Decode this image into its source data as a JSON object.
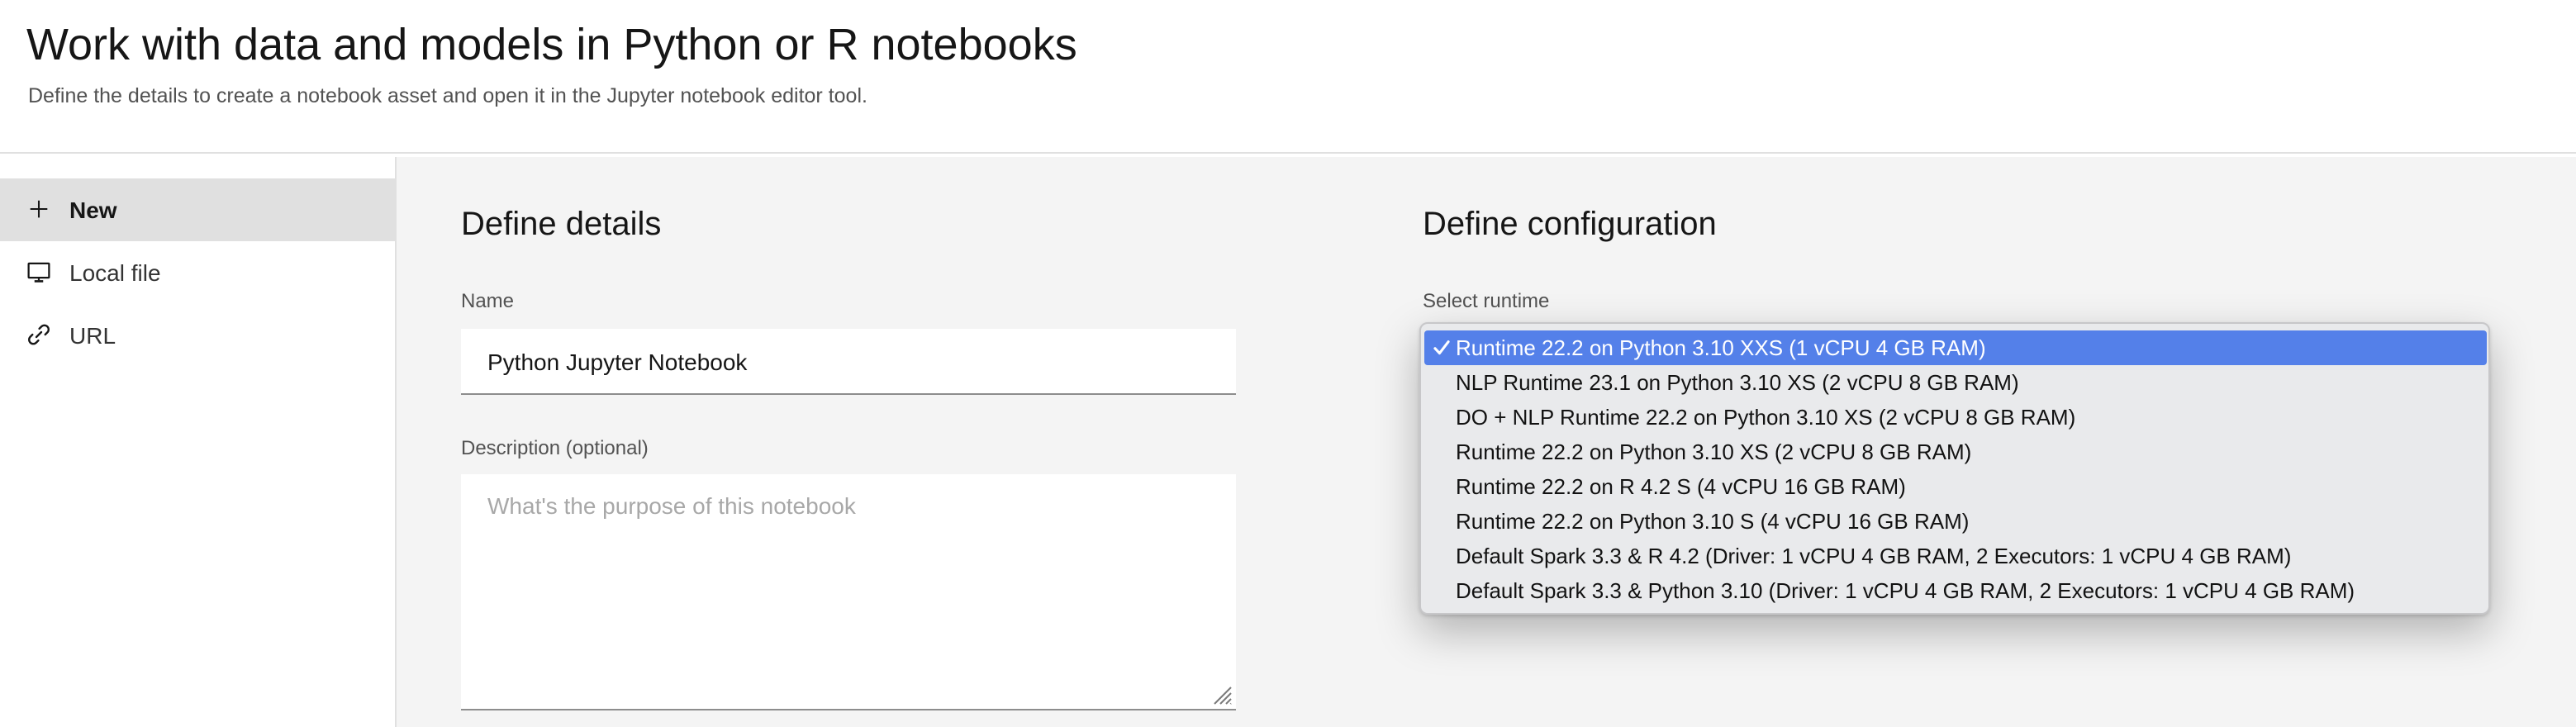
{
  "header": {
    "title": "Work with data and models in Python or R notebooks",
    "subtitle": "Define the details to create a notebook asset and open it in the Jupyter notebook editor tool."
  },
  "sidebar": {
    "items": [
      {
        "label": "New",
        "icon": "plus-icon",
        "selected": true
      },
      {
        "label": "Local file",
        "icon": "monitor-icon",
        "selected": false
      },
      {
        "label": "URL",
        "icon": "link-icon",
        "selected": false
      }
    ]
  },
  "details": {
    "heading": "Define details",
    "name_label": "Name",
    "name_value": "Python Jupyter Notebook",
    "description_label": "Description (optional)",
    "description_placeholder": "What's the purpose of this notebook"
  },
  "configuration": {
    "heading": "Define configuration",
    "runtime_label": "Select runtime",
    "selected_index": 0,
    "options": [
      "Runtime 22.2 on Python 3.10 XXS (1 vCPU 4 GB RAM)",
      "NLP Runtime 23.1 on Python 3.10 XS (2 vCPU 8 GB RAM)",
      "DO + NLP Runtime 22.2 on Python 3.10 XS (2 vCPU 8 GB RAM)",
      "Runtime 22.2 on Python 3.10 XS (2 vCPU 8 GB RAM)",
      "Runtime 22.2 on R 4.2 S (4 vCPU 16 GB RAM)",
      "Runtime 22.2 on Python 3.10 S (4 vCPU 16 GB RAM)",
      "Default Spark 3.3 & R 4.2 (Driver: 1 vCPU 4 GB RAM, 2 Executors: 1 vCPU 4 GB RAM)",
      "Default Spark 3.3 & Python 3.10 (Driver: 1 vCPU 4 GB RAM, 2 Executors: 1 vCPU 4 GB RAM)"
    ]
  },
  "colors": {
    "selection_blue": "#5480e9",
    "sidebar_selected_bg": "#e0e0e0",
    "panel_bg": "#f4f4f4",
    "divider": "#e0e0e0",
    "input_border": "#8d8d8d",
    "text_primary": "#161616",
    "text_secondary": "#525252",
    "placeholder": "#a8a8a8"
  }
}
